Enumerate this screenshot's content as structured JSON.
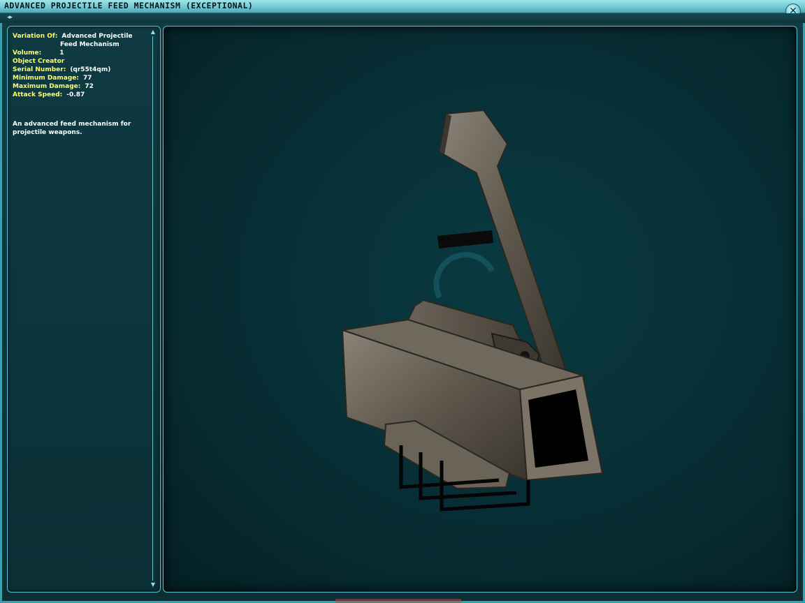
{
  "window": {
    "title": "ADVANCED PROJECTILE FEED MECHANISM (EXCEPTIONAL)",
    "close_glyph": "✕",
    "nav_glyph": "◂▸"
  },
  "item": {
    "variation_label": "Variation Of:",
    "variation_value_line1": "Advanced Projectile",
    "variation_value_line2": "Feed Mechanism",
    "volume_label": "Volume:",
    "volume_value": "1",
    "creator_label": "Object Creator",
    "serial_label": "Serial Number:",
    "serial_value": "(qr55t4qm)",
    "min_damage_label": "Minimum Damage:",
    "min_damage_value": "77",
    "max_damage_label": "Maximum Damage:",
    "max_damage_value": "72",
    "attack_speed_label": "Attack Speed:",
    "attack_speed_value": "-0.87",
    "description": "An advanced feed mechanism for projectile weapons."
  },
  "scroll": {
    "up_glyph": "▲",
    "down_glyph": "▼"
  },
  "colors": {
    "accent": "#55c2cf",
    "label": "#ffff66",
    "value": "#ffffff",
    "viewport_bg": "#062a30"
  },
  "icons": [
    "close-icon",
    "nav-arrows-icon",
    "scroll-up-icon",
    "scroll-down-icon"
  ]
}
